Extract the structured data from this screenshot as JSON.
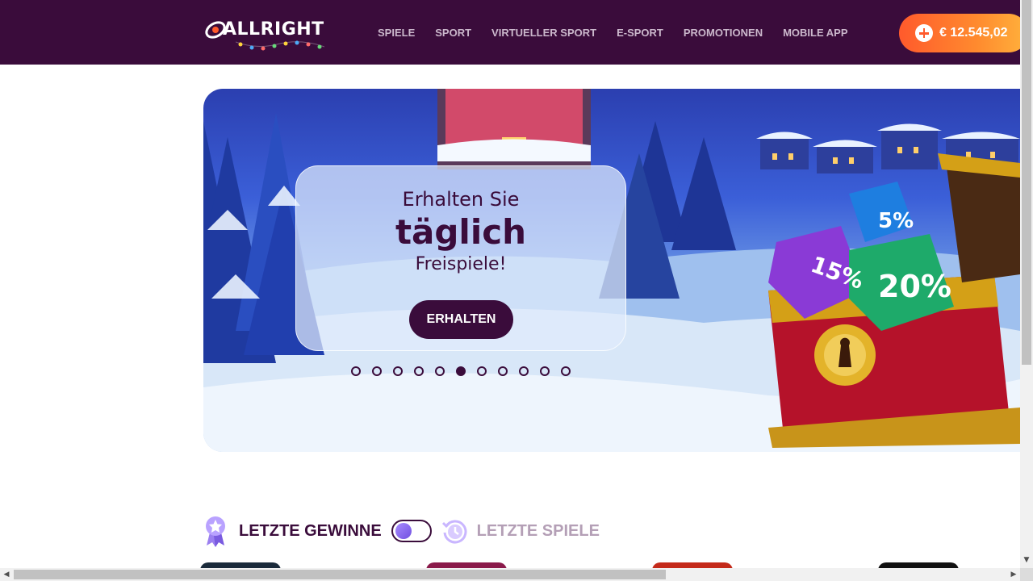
{
  "header": {
    "logo_text": "ALLRIGHT",
    "nav": [
      "SPIELE",
      "SPORT",
      "VIRTUELLER SPORT",
      "E-SPORT",
      "PROMOTIONEN",
      "MOBILE APP"
    ],
    "balance": "€ 12.545,02"
  },
  "banner": {
    "line1": "Erhalten Sie",
    "line2": "täglich",
    "line3": "Freispiele!",
    "cta": "ERHALTEN",
    "slides_total": 11,
    "active_slide": 6,
    "chest_labels": [
      "5%",
      "15%",
      "20%"
    ]
  },
  "section": {
    "tab_active": "LETZTE GEWINNE",
    "tab_inactive": "LETZTE SPIELE",
    "toggle_state": "off"
  },
  "colors": {
    "brand_dark": "#3a0c3b",
    "accent_orange": "#ff7a2e",
    "nav_text": "#cbb8cc"
  },
  "scrollbars": {
    "up_arrow": "▲",
    "down_arrow": "▼",
    "left_arrow": "◀",
    "right_arrow": "▶"
  }
}
